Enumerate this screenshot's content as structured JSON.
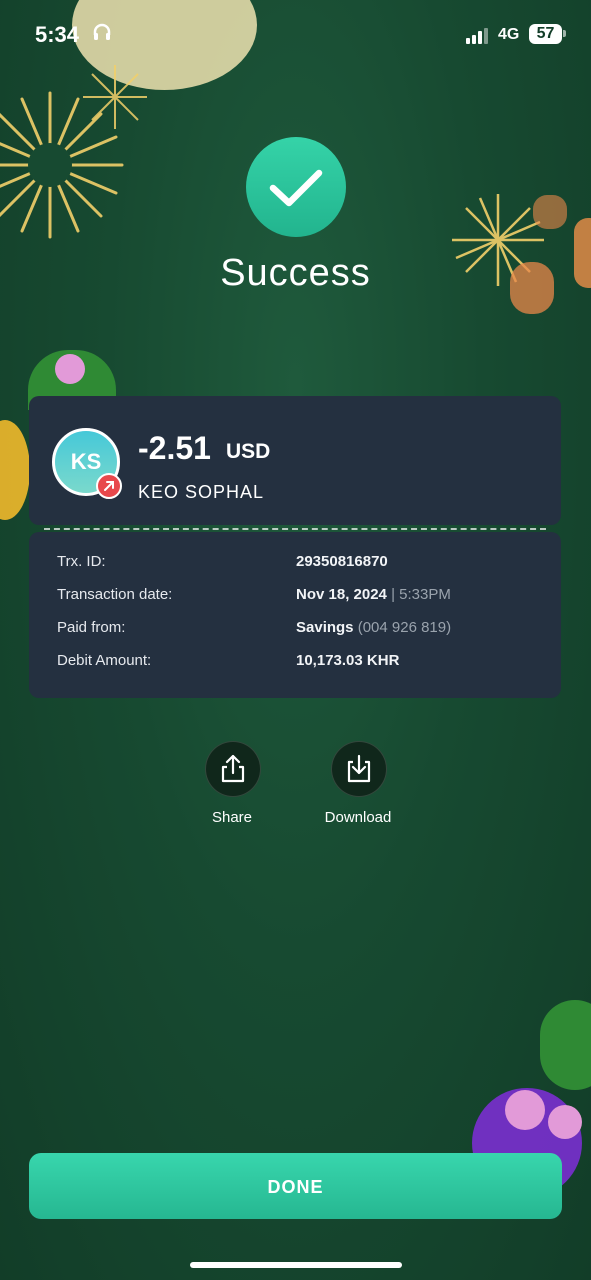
{
  "status_bar": {
    "time": "5:34",
    "network": "4G",
    "battery": "57"
  },
  "result": {
    "title": "Success"
  },
  "transfer": {
    "avatar_initials": "KS",
    "amount": "-2.51",
    "currency": "USD",
    "payee": "KEO SOPHAL"
  },
  "details": {
    "trx_id_label": "Trx. ID:",
    "trx_id_value": "29350816870",
    "date_label": "Transaction date:",
    "date_value": "Nov 18, 2024",
    "time_value": "| 5:33PM",
    "paid_from_label": "Paid from:",
    "paid_from_value": "Savings",
    "paid_from_account": "(004 926 819)",
    "debit_label": "Debit Amount:",
    "debit_value": "10,173.03 KHR"
  },
  "actions": {
    "share_label": "Share",
    "download_label": "Download"
  },
  "done_label": "DONE",
  "colors": {
    "background": "#174a31",
    "accent": "#2cc69d",
    "card": "#243040",
    "badge": "#e8484c"
  }
}
